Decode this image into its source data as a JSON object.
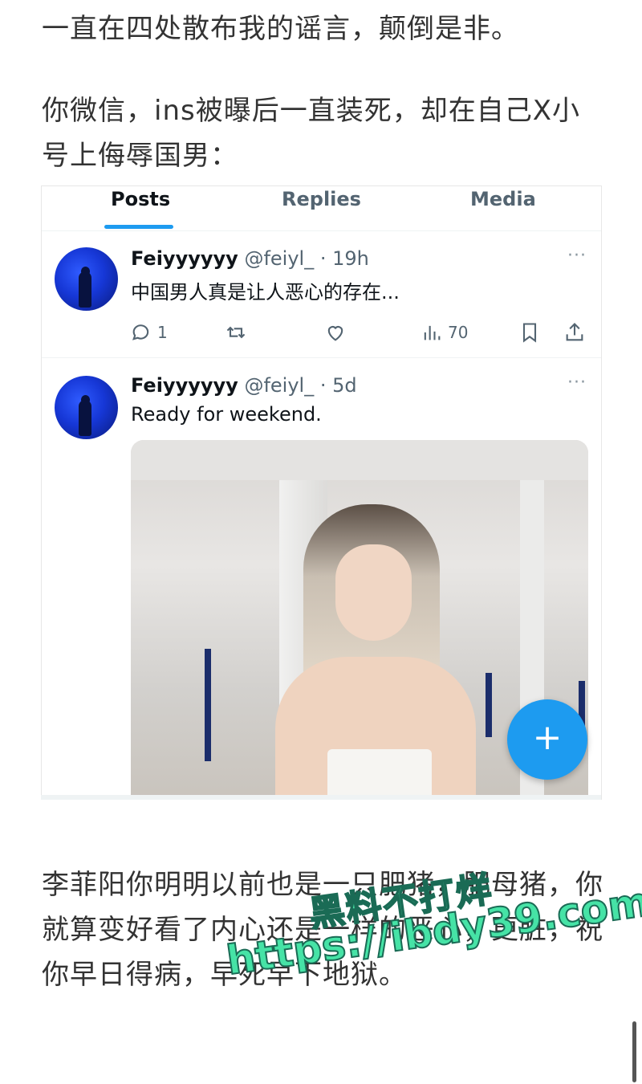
{
  "article": {
    "line1": "一直在四处散布我的谣言，颠倒是非。",
    "line2": "你微信，ins被曝后一直装死，却在自己X小号上侮辱国男：",
    "line3": "李菲阳你明明以前也是一只肥猪，肥母猪，你就算变好看了内心还是一样的恶心，更脏，祝你早日得病，早死早下地狱。"
  },
  "tabs": [
    {
      "label": "Posts",
      "active": true
    },
    {
      "label": "Replies",
      "active": false
    },
    {
      "label": "Media",
      "active": false
    }
  ],
  "posts": [
    {
      "name": "Feiyyyyyy",
      "handle": "@feiyl_ · 19h",
      "text": "中国男人真是让人恶心的存在...",
      "more": "···",
      "replies": "1",
      "views": "70"
    },
    {
      "name": "Feiyyyyyy",
      "handle": "@feiyl_ · 5d",
      "text": "Ready for weekend.",
      "more": "···"
    }
  ],
  "fab": {
    "label": "+"
  },
  "watermark": {
    "cn": "黑料不打烊",
    "url": "https://ibdy39.com"
  },
  "colors": {
    "accent": "#1d9bf0",
    "watermark": "#46e3a6"
  },
  "icons": [
    "reply-icon",
    "repost-icon",
    "like-icon",
    "views-icon",
    "bookmark-icon",
    "share-icon",
    "plus-icon"
  ]
}
